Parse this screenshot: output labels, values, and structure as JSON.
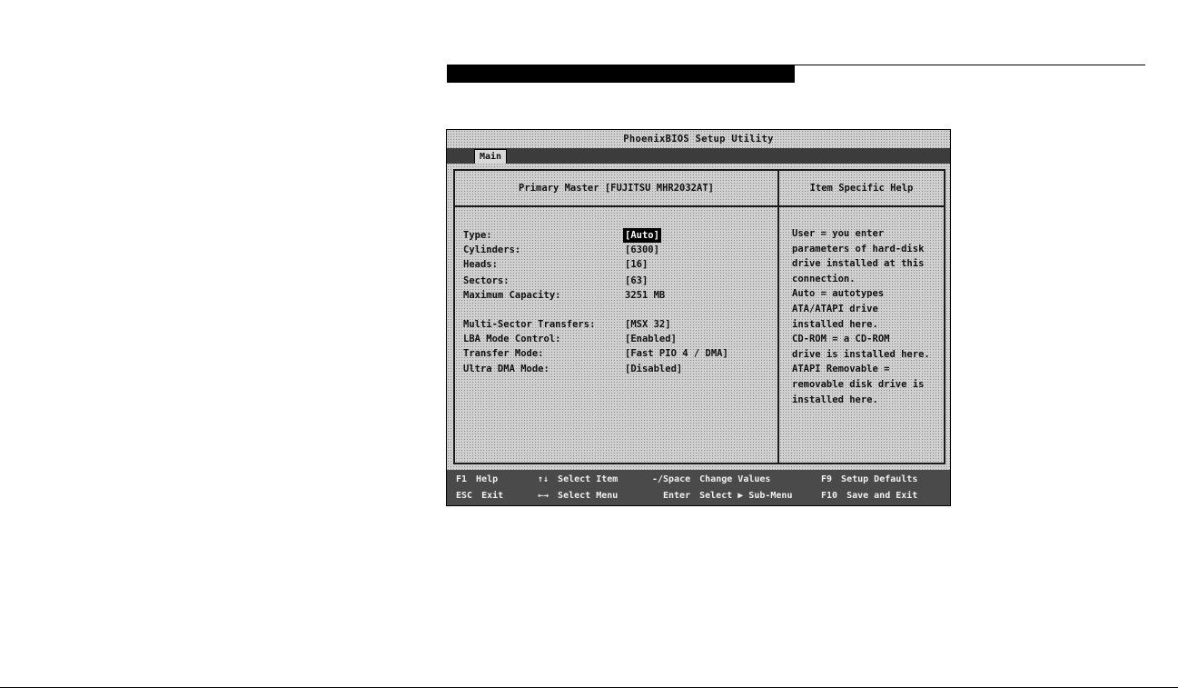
{
  "title": "PhoenixBIOS Setup Utility",
  "menu": {
    "main_tab": "Main"
  },
  "panel": {
    "title": "Primary Master [FUJITSU MHR2032AT]",
    "help_title": "Item Specific Help"
  },
  "settings": [
    {
      "label": "Type:",
      "value": "[Auto]"
    },
    {
      "label": "Cylinders:",
      "value": "[6300]"
    },
    {
      "label": "Heads:",
      "value": "[16]"
    },
    {
      "label": "Sectors:",
      "value": "[63]"
    },
    {
      "label": "Maximum Capacity:",
      "value": "3251 MB"
    },
    {
      "label": "Multi-Sector Transfers:",
      "value": "[MSX 32]"
    },
    {
      "label": "LBA Mode Control:",
      "value": "[Enabled]"
    },
    {
      "label": "Transfer Mode:",
      "value": "[Fast PIO 4 / DMA]"
    },
    {
      "label": "Ultra DMA Mode:",
      "value": "[Disabled]"
    }
  ],
  "help_lines": [
    "User = you enter",
    "parameters of hard-disk",
    "drive installed at this",
    "connection.",
    "Auto = autotypes",
    "ATA/ATAPI drive",
    "installed here.",
    "CD-ROM = a CD-ROM",
    "drive is installed here.",
    "ATAPI Removable =",
    "removable disk drive is",
    "installed here."
  ],
  "footer": {
    "f1_key": "F1",
    "f1_label": "Help",
    "esc_key": "ESC",
    "esc_label": "Exit",
    "updown_icon": "up-down-arrows-icon",
    "updown_label": "Select Item",
    "leftright_icon": "left-right-arrows-icon",
    "leftright_label": "Select Menu",
    "change_key": "-/Space",
    "change_label": "Change Values",
    "enter_key": "Enter",
    "enter_label": "Select ▶ Sub-Menu",
    "f9_key": "F9",
    "f9_label": "Setup Defaults",
    "f10_key": "F10",
    "f10_label": "Save and Exit"
  }
}
